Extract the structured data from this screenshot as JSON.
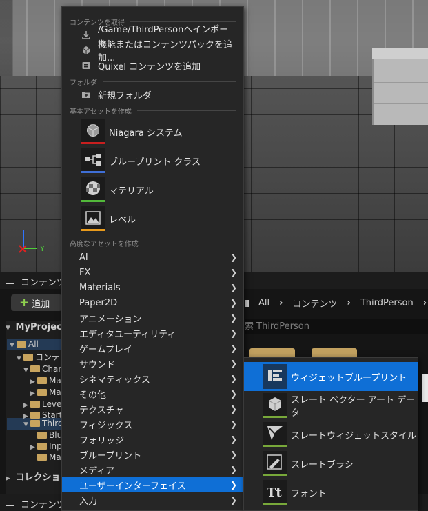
{
  "viewport": {
    "axis_y_label": "Y"
  },
  "browser": {
    "tab_top": "コンテンツ",
    "tab_bottom": "コンテンツ",
    "add_button": "追加",
    "breadcrumb": [
      "All",
      "コンテンツ",
      "ThirdPerson"
    ],
    "search_placeholder": "索 ThirdPerson",
    "tree_header": "MyProject",
    "tree": [
      "All",
      "コンテ",
      "Char",
      "Ma",
      "Ma",
      "Leve",
      "Start",
      "Third",
      "Blu",
      "Inp",
      "Ma"
    ],
    "collections_header": "コレクショ"
  },
  "menu": {
    "sections": {
      "get_content": "コンテンツを取得",
      "folder": "フォルダ",
      "basic_assets": "基本アセットを作成",
      "advanced_assets": "高度なアセットを作成"
    },
    "get_content_items": [
      {
        "label": "/Game/ThirdPersonへインポート...",
        "icon": "import-icon"
      },
      {
        "label": "機能またはコンテンツパックを追加...",
        "icon": "content-pack-icon"
      },
      {
        "label": "Quixel コンテンツを追加",
        "icon": "quixel-icon"
      }
    ],
    "folder_item": {
      "label": "新規フォルダ",
      "icon": "new-folder-icon"
    },
    "basic_assets": [
      {
        "label": "Niagara システム",
        "color": "#c81f1f",
        "icon": "niagara-icon"
      },
      {
        "label": "ブループリント クラス",
        "color": "#3f6fd6",
        "icon": "blueprint-icon"
      },
      {
        "label": "マテリアル",
        "color": "#52b83a",
        "icon": "material-icon"
      },
      {
        "label": "レベル",
        "color": "#e89a1c",
        "icon": "level-icon"
      }
    ],
    "advanced_assets": [
      "AI",
      "FX",
      "Materials",
      "Paper2D",
      "アニメーション",
      "エディタユーティリティ",
      "ゲームプレイ",
      "サウンド",
      "シネマティックス",
      "その他",
      "テクスチャ",
      "フィジックス",
      "フォリッジ",
      "ブループリント",
      "メディア",
      "ユーザーインターフェイス",
      "入力"
    ],
    "active_item": "ユーザーインターフェイス"
  },
  "submenu": {
    "items": [
      {
        "label": "ウィジェットブループリント",
        "icon": "widget-blueprint-icon"
      },
      {
        "label": "スレート ベクター アート データ",
        "icon": "slate-vector-icon"
      },
      {
        "label": "スレートウィジェットスタイル",
        "icon": "slate-widget-style-icon"
      },
      {
        "label": "スレートブラシ",
        "icon": "slate-brush-icon"
      },
      {
        "label": "フォント",
        "icon": "font-icon"
      }
    ],
    "active_index": 0,
    "bar_color": "#78a83a"
  }
}
